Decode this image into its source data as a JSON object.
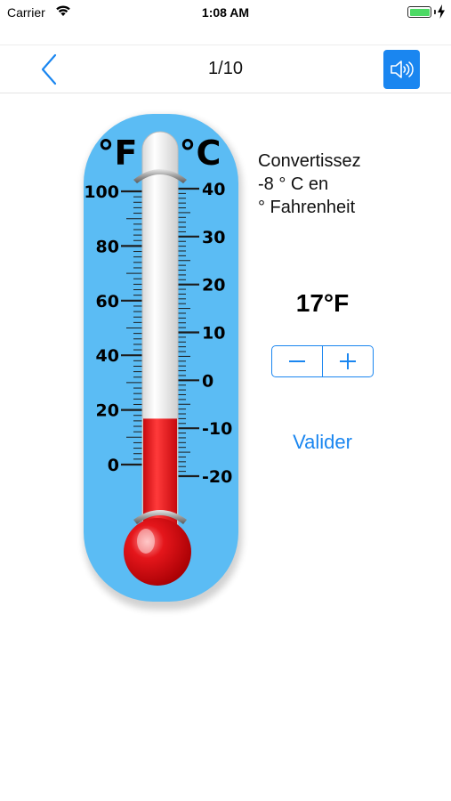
{
  "status_bar": {
    "carrier": "Carrier",
    "time": "1:08 AM",
    "battery_color": "#4cd964"
  },
  "nav": {
    "back_icon": "chevron-left-icon",
    "title": "1/10",
    "sound_icon": "speaker-icon",
    "accent_color": "#1a86f0"
  },
  "thermometer": {
    "fahrenheit_label": "°F",
    "celsius_label": "°C",
    "fahrenheit_ticks": [
      "100",
      "80",
      "60",
      "40",
      "20",
      "0"
    ],
    "celsius_ticks": [
      "40",
      "30",
      "20",
      "10",
      "0",
      "-10",
      "-20"
    ],
    "mercury_level_celsius": -8,
    "body_color": "#5bbcf4",
    "mercury_color": "#e5161b"
  },
  "question": {
    "line1": "Convertissez",
    "line2": "-8 ° C en",
    "line3": "° Fahrenheit"
  },
  "answer": {
    "value": "17°F"
  },
  "stepper": {
    "minus_icon": "minus-icon",
    "plus_icon": "plus-icon"
  },
  "actions": {
    "validate_label": "Valider"
  }
}
